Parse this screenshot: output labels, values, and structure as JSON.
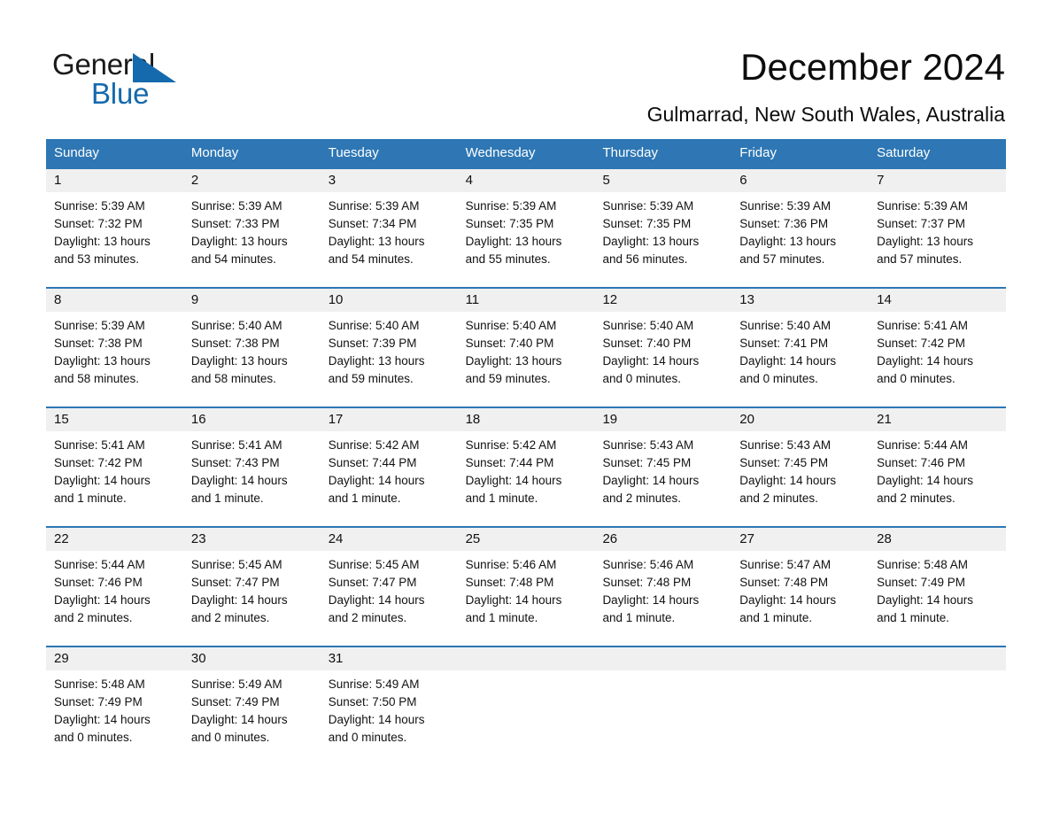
{
  "brand": {
    "name_part1": "General",
    "name_part2": "Blue",
    "accent_color": "#1569ad",
    "triangle_icon": "triangle-icon"
  },
  "header": {
    "title": "December 2024",
    "subtitle": "Gulmarrad, New South Wales, Australia"
  },
  "calendar": {
    "header_bg": "#2e77b4",
    "daynum_bg": "#f0f0f0",
    "weekdays": [
      "Sunday",
      "Monday",
      "Tuesday",
      "Wednesday",
      "Thursday",
      "Friday",
      "Saturday"
    ],
    "weeks": [
      [
        {
          "day": "1",
          "sunrise": "Sunrise: 5:39 AM",
          "sunset": "Sunset: 7:32 PM",
          "daylight1": "Daylight: 13 hours",
          "daylight2": "and 53 minutes."
        },
        {
          "day": "2",
          "sunrise": "Sunrise: 5:39 AM",
          "sunset": "Sunset: 7:33 PM",
          "daylight1": "Daylight: 13 hours",
          "daylight2": "and 54 minutes."
        },
        {
          "day": "3",
          "sunrise": "Sunrise: 5:39 AM",
          "sunset": "Sunset: 7:34 PM",
          "daylight1": "Daylight: 13 hours",
          "daylight2": "and 54 minutes."
        },
        {
          "day": "4",
          "sunrise": "Sunrise: 5:39 AM",
          "sunset": "Sunset: 7:35 PM",
          "daylight1": "Daylight: 13 hours",
          "daylight2": "and 55 minutes."
        },
        {
          "day": "5",
          "sunrise": "Sunrise: 5:39 AM",
          "sunset": "Sunset: 7:35 PM",
          "daylight1": "Daylight: 13 hours",
          "daylight2": "and 56 minutes."
        },
        {
          "day": "6",
          "sunrise": "Sunrise: 5:39 AM",
          "sunset": "Sunset: 7:36 PM",
          "daylight1": "Daylight: 13 hours",
          "daylight2": "and 57 minutes."
        },
        {
          "day": "7",
          "sunrise": "Sunrise: 5:39 AM",
          "sunset": "Sunset: 7:37 PM",
          "daylight1": "Daylight: 13 hours",
          "daylight2": "and 57 minutes."
        }
      ],
      [
        {
          "day": "8",
          "sunrise": "Sunrise: 5:39 AM",
          "sunset": "Sunset: 7:38 PM",
          "daylight1": "Daylight: 13 hours",
          "daylight2": "and 58 minutes."
        },
        {
          "day": "9",
          "sunrise": "Sunrise: 5:40 AM",
          "sunset": "Sunset: 7:38 PM",
          "daylight1": "Daylight: 13 hours",
          "daylight2": "and 58 minutes."
        },
        {
          "day": "10",
          "sunrise": "Sunrise: 5:40 AM",
          "sunset": "Sunset: 7:39 PM",
          "daylight1": "Daylight: 13 hours",
          "daylight2": "and 59 minutes."
        },
        {
          "day": "11",
          "sunrise": "Sunrise: 5:40 AM",
          "sunset": "Sunset: 7:40 PM",
          "daylight1": "Daylight: 13 hours",
          "daylight2": "and 59 minutes."
        },
        {
          "day": "12",
          "sunrise": "Sunrise: 5:40 AM",
          "sunset": "Sunset: 7:40 PM",
          "daylight1": "Daylight: 14 hours",
          "daylight2": "and 0 minutes."
        },
        {
          "day": "13",
          "sunrise": "Sunrise: 5:40 AM",
          "sunset": "Sunset: 7:41 PM",
          "daylight1": "Daylight: 14 hours",
          "daylight2": "and 0 minutes."
        },
        {
          "day": "14",
          "sunrise": "Sunrise: 5:41 AM",
          "sunset": "Sunset: 7:42 PM",
          "daylight1": "Daylight: 14 hours",
          "daylight2": "and 0 minutes."
        }
      ],
      [
        {
          "day": "15",
          "sunrise": "Sunrise: 5:41 AM",
          "sunset": "Sunset: 7:42 PM",
          "daylight1": "Daylight: 14 hours",
          "daylight2": "and 1 minute."
        },
        {
          "day": "16",
          "sunrise": "Sunrise: 5:41 AM",
          "sunset": "Sunset: 7:43 PM",
          "daylight1": "Daylight: 14 hours",
          "daylight2": "and 1 minute."
        },
        {
          "day": "17",
          "sunrise": "Sunrise: 5:42 AM",
          "sunset": "Sunset: 7:44 PM",
          "daylight1": "Daylight: 14 hours",
          "daylight2": "and 1 minute."
        },
        {
          "day": "18",
          "sunrise": "Sunrise: 5:42 AM",
          "sunset": "Sunset: 7:44 PM",
          "daylight1": "Daylight: 14 hours",
          "daylight2": "and 1 minute."
        },
        {
          "day": "19",
          "sunrise": "Sunrise: 5:43 AM",
          "sunset": "Sunset: 7:45 PM",
          "daylight1": "Daylight: 14 hours",
          "daylight2": "and 2 minutes."
        },
        {
          "day": "20",
          "sunrise": "Sunrise: 5:43 AM",
          "sunset": "Sunset: 7:45 PM",
          "daylight1": "Daylight: 14 hours",
          "daylight2": "and 2 minutes."
        },
        {
          "day": "21",
          "sunrise": "Sunrise: 5:44 AM",
          "sunset": "Sunset: 7:46 PM",
          "daylight1": "Daylight: 14 hours",
          "daylight2": "and 2 minutes."
        }
      ],
      [
        {
          "day": "22",
          "sunrise": "Sunrise: 5:44 AM",
          "sunset": "Sunset: 7:46 PM",
          "daylight1": "Daylight: 14 hours",
          "daylight2": "and 2 minutes."
        },
        {
          "day": "23",
          "sunrise": "Sunrise: 5:45 AM",
          "sunset": "Sunset: 7:47 PM",
          "daylight1": "Daylight: 14 hours",
          "daylight2": "and 2 minutes."
        },
        {
          "day": "24",
          "sunrise": "Sunrise: 5:45 AM",
          "sunset": "Sunset: 7:47 PM",
          "daylight1": "Daylight: 14 hours",
          "daylight2": "and 2 minutes."
        },
        {
          "day": "25",
          "sunrise": "Sunrise: 5:46 AM",
          "sunset": "Sunset: 7:48 PM",
          "daylight1": "Daylight: 14 hours",
          "daylight2": "and 1 minute."
        },
        {
          "day": "26",
          "sunrise": "Sunrise: 5:46 AM",
          "sunset": "Sunset: 7:48 PM",
          "daylight1": "Daylight: 14 hours",
          "daylight2": "and 1 minute."
        },
        {
          "day": "27",
          "sunrise": "Sunrise: 5:47 AM",
          "sunset": "Sunset: 7:48 PM",
          "daylight1": "Daylight: 14 hours",
          "daylight2": "and 1 minute."
        },
        {
          "day": "28",
          "sunrise": "Sunrise: 5:48 AM",
          "sunset": "Sunset: 7:49 PM",
          "daylight1": "Daylight: 14 hours",
          "daylight2": "and 1 minute."
        }
      ],
      [
        {
          "day": "29",
          "sunrise": "Sunrise: 5:48 AM",
          "sunset": "Sunset: 7:49 PM",
          "daylight1": "Daylight: 14 hours",
          "daylight2": "and 0 minutes."
        },
        {
          "day": "30",
          "sunrise": "Sunrise: 5:49 AM",
          "sunset": "Sunset: 7:49 PM",
          "daylight1": "Daylight: 14 hours",
          "daylight2": "and 0 minutes."
        },
        {
          "day": "31",
          "sunrise": "Sunrise: 5:49 AM",
          "sunset": "Sunset: 7:50 PM",
          "daylight1": "Daylight: 14 hours",
          "daylight2": "and 0 minutes."
        },
        {
          "day": "",
          "sunrise": "",
          "sunset": "",
          "daylight1": "",
          "daylight2": ""
        },
        {
          "day": "",
          "sunrise": "",
          "sunset": "",
          "daylight1": "",
          "daylight2": ""
        },
        {
          "day": "",
          "sunrise": "",
          "sunset": "",
          "daylight1": "",
          "daylight2": ""
        },
        {
          "day": "",
          "sunrise": "",
          "sunset": "",
          "daylight1": "",
          "daylight2": ""
        }
      ]
    ]
  }
}
